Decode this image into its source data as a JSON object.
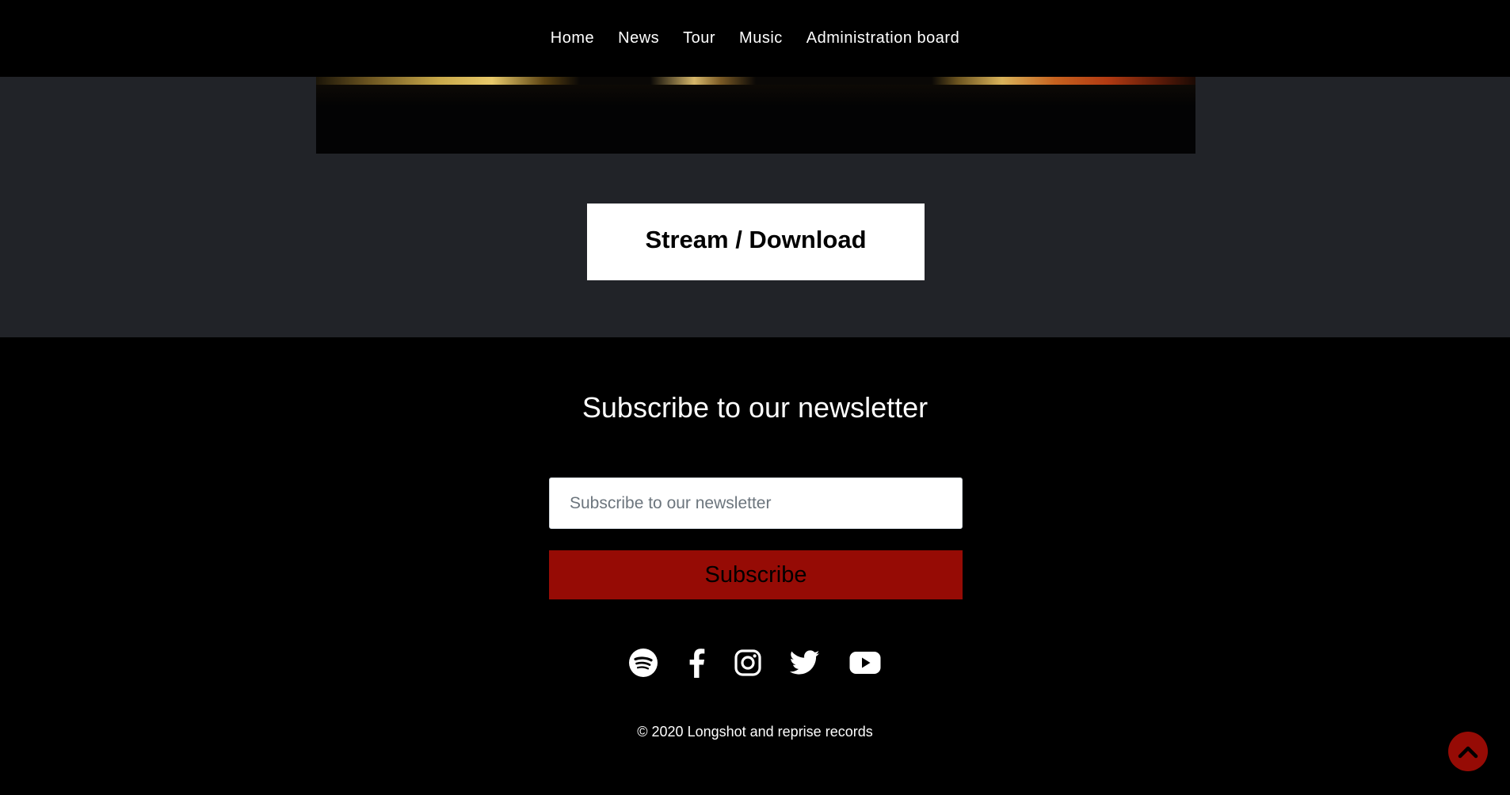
{
  "nav": {
    "items": [
      {
        "label": "Home"
      },
      {
        "label": "News"
      },
      {
        "label": "Tour"
      },
      {
        "label": "Music"
      },
      {
        "label": "Administration board"
      }
    ]
  },
  "music": {
    "stream_label": "Stream / Download"
  },
  "newsletter": {
    "title": "Subscribe to our newsletter",
    "input_placeholder": "Subscribe to our newsletter",
    "input_value": "",
    "button_label": "Subscribe"
  },
  "social": {
    "icons": [
      "spotify-icon",
      "facebook-icon",
      "instagram-icon",
      "twitter-icon",
      "youtube-icon"
    ]
  },
  "footer": {
    "copyright": "© 2020 Longshot and reprise records"
  },
  "colors": {
    "accent": "#960b05",
    "section_bg": "#212328",
    "footer_bg": "#000000"
  }
}
